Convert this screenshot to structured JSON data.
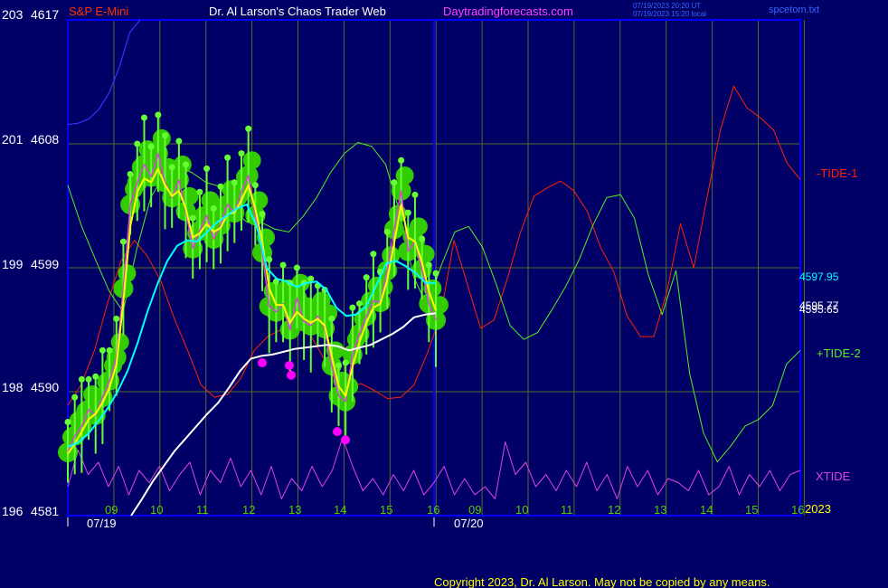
{
  "header": {
    "instrument": "S&P E-Mini",
    "site_title": "Dr. Al Larson's Chaos Trader Web",
    "site_url": "Daytradingforecasts.com",
    "timestamp_line1": "07/19/2023 20:20 UT",
    "timestamp_line2": "07/19/2023 15:20 local",
    "file_name": "spcetom.txt"
  },
  "footer": {
    "copyright": "Copyright 2023, Dr. Al Larson. May not be copied by any means."
  },
  "colors": {
    "background": "#000066",
    "frame": "#0000ff",
    "grid": "#556b2f",
    "price_bar": "#66ff33",
    "price_halo": "#33cc00",
    "ema_fast": "#ffff00",
    "ema_mid": "#00ffff",
    "ema_slow": "#ffffff",
    "tide_1": "#ff2200",
    "tide_2": "#55ee22",
    "xtide": "#dd44dd",
    "magenta_marker": "#ff00ff",
    "blue_line": "#3333ff"
  },
  "chart_data": {
    "type": "line",
    "title": "S&P E-Mini",
    "y_axis": {
      "range": [
        4581,
        4617
      ],
      "ticks": [
        {
          "code": "203",
          "price": "4617",
          "value": 4617
        },
        {
          "code": "201",
          "price": "4608",
          "value": 4608
        },
        {
          "code": "199",
          "price": "4599",
          "value": 4599
        },
        {
          "code": "198",
          "price": "4590",
          "value": 4590
        },
        {
          "code": "196",
          "price": "4581",
          "value": 4581
        }
      ]
    },
    "x_axis": {
      "hour_labels_day1": [
        "09",
        "10",
        "11",
        "12",
        "13",
        "14",
        "15",
        "16"
      ],
      "hour_labels_day2": [
        "09",
        "10",
        "11",
        "12",
        "13",
        "14",
        "15",
        "16"
      ],
      "date_labels": [
        "07/19",
        "07/20"
      ],
      "year_label": "2023"
    },
    "right_labels": {
      "tide1": "-TIDE-1",
      "tide2": "+TIDE-2",
      "xtide": "XTIDE",
      "price_cyan": "4597.95",
      "price_white_a": "4595.77",
      "price_white_b": "4595.65"
    },
    "series": [
      {
        "name": "S&P E-Mini",
        "color": "#66ff33",
        "values": [
          4585.6,
          4586.8,
          4587.5,
          4588.7,
          4588.3,
          4589.6,
          4590.8,
          4592.5,
          4597.5,
          4603.6,
          4605.2,
          4606.5,
          4605.6,
          4607.3,
          4605.2,
          4604.1,
          4605.4,
          4603.1,
          4600.4,
          4601.7,
          4602.8,
          4601.1,
          4602.1,
          4603.6,
          4603.0,
          4604.5,
          4605.7,
          4602.8,
          4600.1,
          4596.2,
          4595.8,
          4596.4,
          4594.5,
          4596.8,
          4595.1,
          4594.8,
          4595.5,
          4594.6,
          4591.9,
          4589.7,
          4589.3,
          4592.7,
          4594.2,
          4595.5,
          4596.6,
          4596.5,
          4598.8,
          4601.8,
          4604.6,
          4600.2,
          4600.9,
          4598.9,
          4596.4,
          4595.2
        ]
      },
      {
        "name": "",
        "color": "#ffff00",
        "values": [
          4585.5,
          4586.2,
          4587.1,
          4588.0,
          4588.4,
          4589.2,
          4590.3,
          4592.0,
          4596.5,
          4602.0,
          4604.5,
          4605.5,
          4605.2,
          4606.2,
          4605.0,
          4604.2,
          4604.6,
          4603.3,
          4601.2,
          4601.5,
          4602.2,
          4601.6,
          4601.9,
          4602.9,
          4603.0,
          4603.9,
          4605.0,
          4603.3,
          4600.9,
          4597.5,
          4596.3,
          4596.3,
          4595.0,
          4595.8,
          4595.3,
          4595.0,
          4595.3,
          4594.8,
          4592.6,
          4590.4,
          4589.7,
          4591.8,
          4593.6,
          4595.0,
          4596.1,
          4596.4,
          4598.1,
          4600.8,
          4603.6,
          4601.2,
          4600.9,
          4599.4,
          4597.3,
          4595.9
        ]
      },
      {
        "name": "",
        "color": "#00ffff",
        "values": [
          4586.0,
          4586.3,
          4586.9,
          4587.8,
          4588.8,
          4590.0,
          4591.5,
          4593.5,
          4595.8,
          4597.8,
          4599.5,
          4600.6,
          4601.0,
          4600.9,
          4601.6,
          4602.3,
          4602.8,
          4603.3,
          4603.6,
          4602.0,
          4599.0,
          4598.2,
          4598.0,
          4597.6,
          4597.9,
          4598.0,
          4597.4,
          4596.1,
          4595.5,
          4595.6,
          4596.2,
          4597.7,
          4599.3,
          4599.5,
          4599.1,
          4598.6,
          4597.9,
          4597.9
        ]
      },
      {
        "name": "",
        "color": "#ffffff",
        "values": [
          4581.0,
          4582.2,
          4583.5,
          4584.6,
          4585.7,
          4586.6,
          4587.5,
          4588.4,
          4589.2,
          4590.3,
          4591.5,
          4592.4,
          4592.6,
          4592.7,
          4592.9,
          4593.1,
          4593.2,
          4593.3,
          4593.4,
          4593.3,
          4593.0,
          4593.2,
          4593.4,
          4593.8,
          4594.2,
          4594.7,
          4595.4,
          4595.6,
          4595.7
        ]
      },
      {
        "name": "-TIDE-1",
        "color": "#ff2200",
        "values": [
          4589.0,
          4590.5,
          4593.0,
          4596.5,
          4599.5,
          4601.0,
          4599.8,
          4598.0,
          4595.3,
          4593.0,
          4590.5,
          4589.6,
          4589.8,
          4591.0,
          4593.0,
          4594.0,
          4594.5,
          4595.5,
          4594.5,
          4592.8,
          4591.0,
          4590.2,
          4590.6,
          4590.1,
          4589.5,
          4589.6,
          4590.5,
          4592.8,
          4595.6,
          4601.0,
          4597.8,
          4594.6,
          4595.2,
          4598.2,
          4601.6,
          4604.2,
          4604.8,
          4605.3,
          4604.6,
          4603.1,
          4600.5,
          4598.7,
          4595.5,
          4594.0,
          4594.0,
          4597.3,
          4602.2,
          4599.0,
          4604.1,
          4609.0,
          4612.2,
          4610.6,
          4609.9,
          4609.0,
          4606.6,
          4605.4
        ]
      },
      {
        "name": "+TIDE-2",
        "color": "#55ee22",
        "values": [
          4605.0,
          4602.0,
          4599.6,
          4597.3,
          4595.8,
          4600.4,
          4604.1,
          4605.8,
          4606.4,
          4605.9,
          4605.2,
          4604.9,
          4603.1,
          4602.3,
          4602.3,
          4601.8,
          4601.6,
          4602.7,
          4604.1,
          4605.9,
          4607.3,
          4608.1,
          4607.8,
          4606.5,
          4603.1,
          4598.4,
          4596.2,
          4599.1,
          4601.6,
          4602.0,
          4600.5,
          4597.8,
          4594.8,
          4593.8,
          4594.3,
          4595.9,
          4597.6,
          4599.6,
          4602.1,
          4604.1,
          4604.3,
          4602.6,
          4598.5,
          4595.6,
          4598.8,
          4591.3,
          4587.0,
          4584.9,
          4586.1,
          4587.5,
          4588.0,
          4589.0,
          4592.0,
          4593.0
        ]
      },
      {
        "name": "XTIDE",
        "color": "#dd44dd",
        "values": [
          0.3,
          0.75,
          0.45,
          0.6,
          0.3,
          0.55,
          0.2,
          0.5,
          0.35,
          0.55,
          0.25,
          0.45,
          0.6,
          0.2,
          0.5,
          0.35,
          0.65,
          0.3,
          0.5,
          0.2,
          0.55,
          0.15,
          0.4,
          0.25,
          0.55,
          0.3,
          0.5,
          0.9,
          0.55,
          0.25,
          0.4,
          0.2,
          0.45,
          0.25,
          0.5,
          0.2,
          0.35,
          0.55,
          0.2,
          0.4,
          0.2,
          0.3,
          0.15,
          0.85,
          0.45,
          0.6,
          0.3,
          0.45,
          0.25,
          0.5,
          0.3,
          0.6,
          0.25,
          0.45,
          0.15,
          0.55,
          0.3,
          0.5,
          0.2,
          0.4,
          0.35,
          0.25,
          0.5,
          0.2,
          0.3,
          0.55,
          0.2,
          0.45,
          0.3,
          0.5,
          0.25,
          0.45,
          0.5
        ]
      },
      {
        "name": "",
        "color": "#3333ff",
        "values": [
          4609.4,
          4609.5,
          4609.8,
          4610.5,
          4611.7,
          4613.6,
          4616.1,
          4617.0
        ]
      }
    ],
    "magenta_markers": [
      4592.1,
      4591.9,
      4591.2,
      4587.1,
      4586.5
    ],
    "grid": true
  }
}
